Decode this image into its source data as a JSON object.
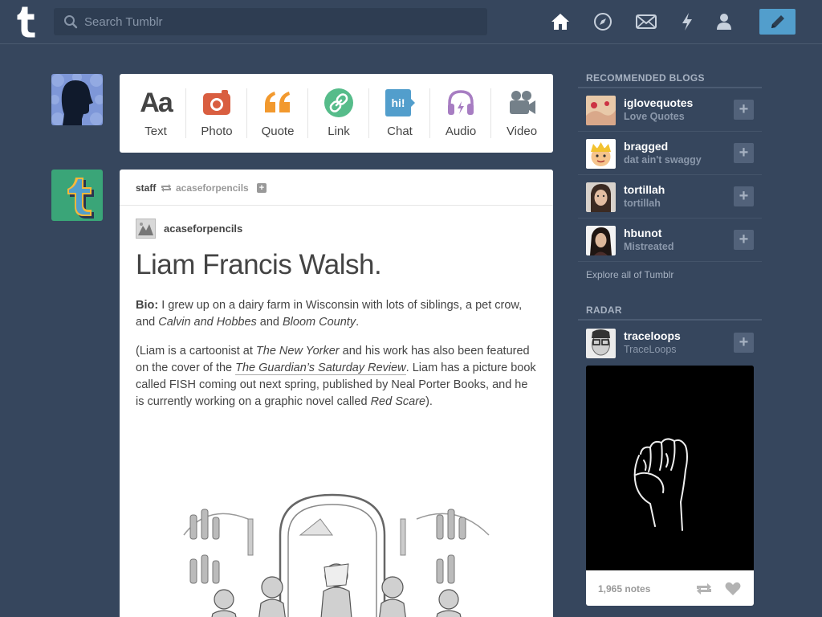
{
  "header": {
    "search_placeholder": "Search Tumblr"
  },
  "post_types": [
    {
      "label": "Text",
      "icon": "text-icon",
      "color": "#444444"
    },
    {
      "label": "Photo",
      "icon": "camera-icon",
      "color": "#d95e40"
    },
    {
      "label": "Quote",
      "icon": "quote-icon",
      "color": "#f2992e"
    },
    {
      "label": "Link",
      "icon": "link-icon",
      "color": "#56bc8a"
    },
    {
      "label": "Chat",
      "icon": "chat-icon",
      "color": "#529ecc"
    },
    {
      "label": "Audio",
      "icon": "headphones-icon",
      "color": "#a77dc2"
    },
    {
      "label": "Video",
      "icon": "video-camera-icon",
      "color": "#748089"
    }
  ],
  "chat_icon_text": "hi!",
  "post": {
    "reblogger": "staff",
    "reblog_source": "acaseforpencils",
    "source_blog": "acaseforpencils",
    "title": "Liam Francis Walsh.",
    "bio_label": "Bio:",
    "bio_text_1": " I grew up on a dairy farm in Wisconsin with lots of siblings, a pet crow, and ",
    "bio_italic_1": "Calvin and Hobbes",
    "bio_text_2": " and ",
    "bio_italic_2": "Bloom County",
    "bio_text_3": ".",
    "p2_text_1": "(Liam is a cartoonist at ",
    "p2_italic_1": "The New Yorker",
    "p2_text_2": " and his work has also been featured on the cover of the ",
    "p2_link": "The Guardian’s Saturday Review",
    "p2_text_3": ". Liam has a picture book called FISH coming out next spring, published by Neal Porter Books, and he is currently working on a graphic novel called ",
    "p2_italic_2": "Red Scare",
    "p2_text_4": ")."
  },
  "sidebar": {
    "recommended_heading": "RECOMMENDED BLOGS",
    "blogs": [
      {
        "name": "iglovequotes",
        "title": "Love Quotes"
      },
      {
        "name": "bragged",
        "title": "dat ain't swaggy"
      },
      {
        "name": "tortillah",
        "title": "tortillah"
      },
      {
        "name": "hbunot",
        "title": "Mistreated"
      }
    ],
    "explore": "Explore all of Tumblr",
    "radar_heading": "RADAR",
    "radar_blog": {
      "name": "traceloops",
      "title": "TraceLoops"
    },
    "radar_notes": "1,965 notes"
  },
  "colors": {
    "background": "#36465d",
    "accent": "#529ecc"
  }
}
